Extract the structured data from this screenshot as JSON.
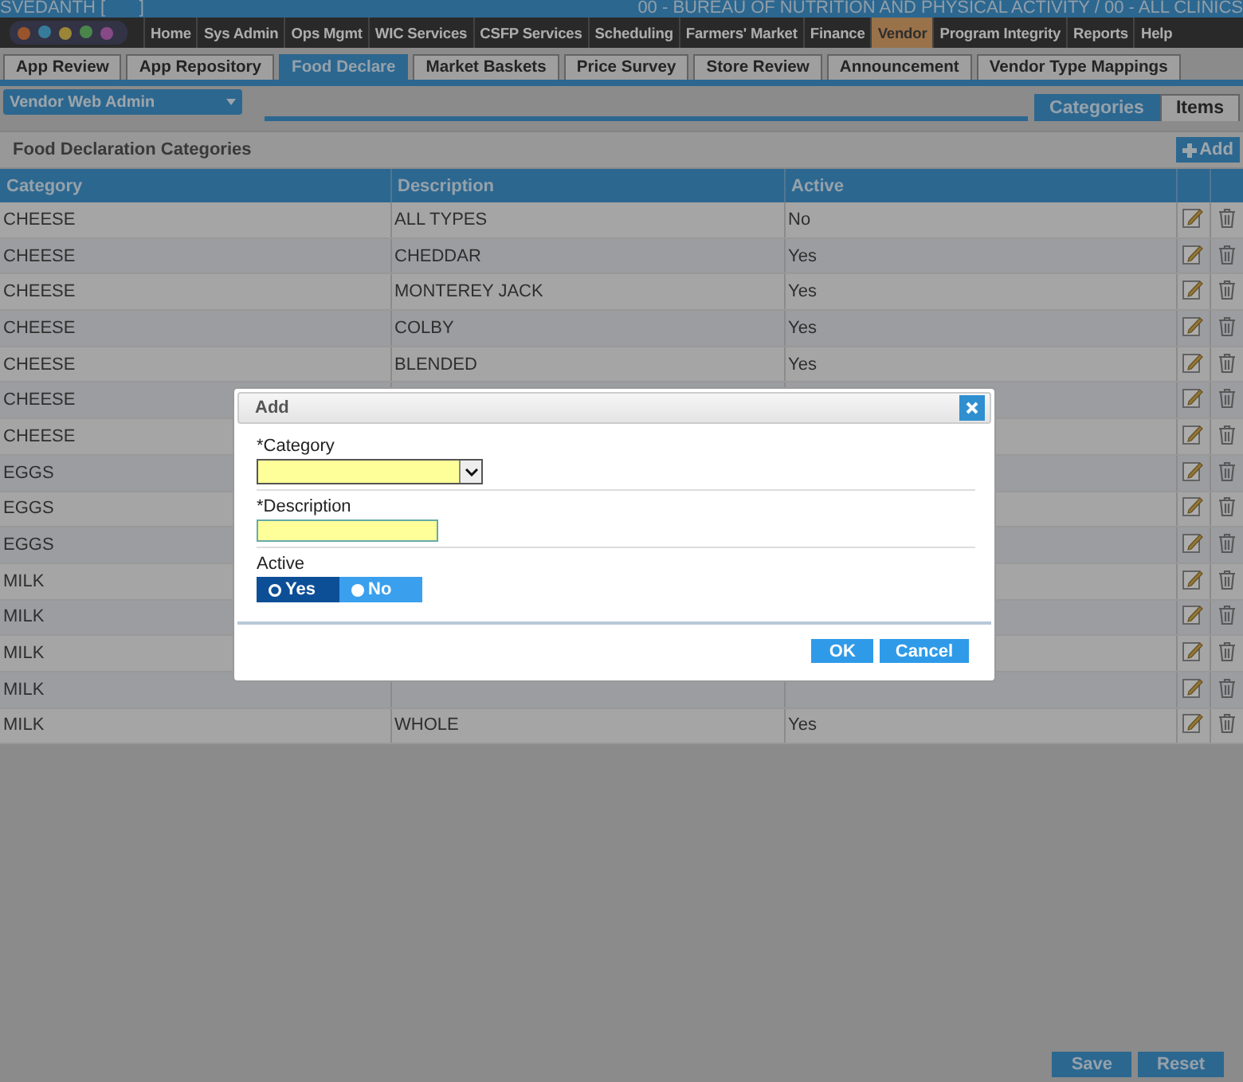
{
  "header": {
    "user": "SVEDANTH [       ]",
    "org": "00 - BUREAU OF NUTRITION AND PHYSICAL ACTIVITY / 00 - ALL CLINICS"
  },
  "nav": [
    {
      "label": "Home",
      "selected": false
    },
    {
      "label": "Sys Admin",
      "selected": false
    },
    {
      "label": "Ops Mgmt",
      "selected": false
    },
    {
      "label": "WIC Services",
      "selected": false
    },
    {
      "label": "CSFP Services",
      "selected": false
    },
    {
      "label": "Scheduling",
      "selected": false
    },
    {
      "label": "Farmers' Market",
      "selected": false
    },
    {
      "label": "Finance",
      "selected": false
    },
    {
      "label": "Vendor",
      "selected": true
    },
    {
      "label": "Program Integrity",
      "selected": false
    },
    {
      "label": "Reports",
      "selected": false
    },
    {
      "label": "Help",
      "selected": false
    }
  ],
  "tabs": [
    {
      "label": "App Review",
      "selected": false
    },
    {
      "label": "App Repository",
      "selected": false
    },
    {
      "label": "Food Declare",
      "selected": true
    },
    {
      "label": "Market Baskets",
      "selected": false
    },
    {
      "label": "Price Survey",
      "selected": false
    },
    {
      "label": "Store Review",
      "selected": false
    },
    {
      "label": "Announcement",
      "selected": false
    },
    {
      "label": "Vendor Type Mappings",
      "selected": false
    }
  ],
  "module_select": {
    "value": "Vendor Web Admin"
  },
  "view_tabs": [
    {
      "label": "Categories",
      "selected": true
    },
    {
      "label": "Items",
      "selected": false
    }
  ],
  "section": {
    "title": "Food Declaration Categories",
    "add_button": "Add"
  },
  "table": {
    "columns": [
      "Category",
      "Description",
      "Active"
    ],
    "rows": [
      {
        "category": "CHEESE",
        "description": "ALL TYPES",
        "active": "No"
      },
      {
        "category": "CHEESE",
        "description": "CHEDDAR",
        "active": "Yes"
      },
      {
        "category": "CHEESE",
        "description": "MONTEREY JACK",
        "active": "Yes"
      },
      {
        "category": "CHEESE",
        "description": "COLBY",
        "active": "Yes"
      },
      {
        "category": "CHEESE",
        "description": "BLENDED",
        "active": "Yes"
      },
      {
        "category": "CHEESE"
      },
      {
        "category": "CHEESE"
      },
      {
        "category": "EGGS"
      },
      {
        "category": "EGGS"
      },
      {
        "category": "EGGS"
      },
      {
        "category": "MILK"
      },
      {
        "category": "MILK"
      },
      {
        "category": "MILK"
      },
      {
        "category": "MILK"
      },
      {
        "category": "MILK",
        "description": "WHOLE",
        "active": "Yes"
      }
    ]
  },
  "footer_buttons": [
    "Save",
    "Reset"
  ],
  "dialog": {
    "title": "Add",
    "fields": [
      {
        "kind": "select",
        "label": "*Category"
      },
      {
        "kind": "text",
        "label": "*Description"
      },
      {
        "kind": "toggle",
        "label": "Active",
        "options": [
          {
            "label": "Yes",
            "selected": true
          },
          {
            "label": "No",
            "selected": false
          }
        ]
      }
    ],
    "buttons": [
      "OK",
      "Cancel"
    ]
  }
}
